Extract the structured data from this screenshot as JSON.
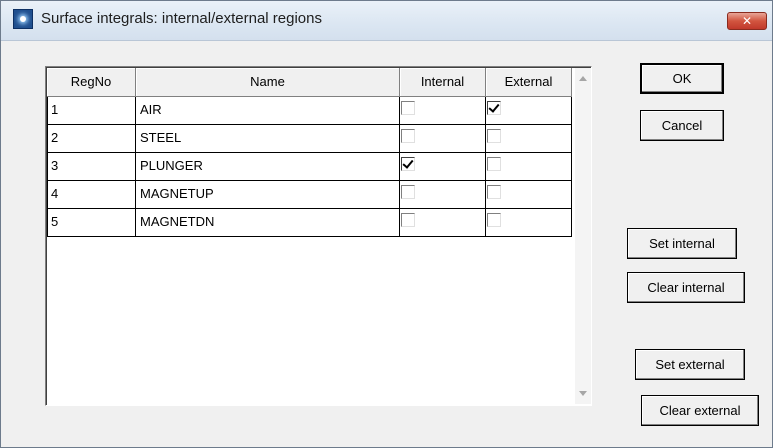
{
  "window": {
    "title": "Surface integrals: internal/external regions",
    "close_label": "✕"
  },
  "grid": {
    "headers": [
      "RegNo",
      "Name",
      "Internal",
      "External"
    ],
    "rows": [
      {
        "regno": "1",
        "name": "AIR",
        "internal": false,
        "external": true
      },
      {
        "regno": "2",
        "name": "STEEL",
        "internal": false,
        "external": false
      },
      {
        "regno": "3",
        "name": "PLUNGER",
        "internal": true,
        "external": false
      },
      {
        "regno": "4",
        "name": "MAGNETUP",
        "internal": false,
        "external": false
      },
      {
        "regno": "5",
        "name": "MAGNETDN",
        "internal": false,
        "external": false
      }
    ]
  },
  "buttons": {
    "ok": "OK",
    "cancel": "Cancel",
    "set_internal": "Set internal",
    "clear_internal": "Clear internal",
    "set_external": "Set external",
    "clear_external": "Clear external"
  }
}
